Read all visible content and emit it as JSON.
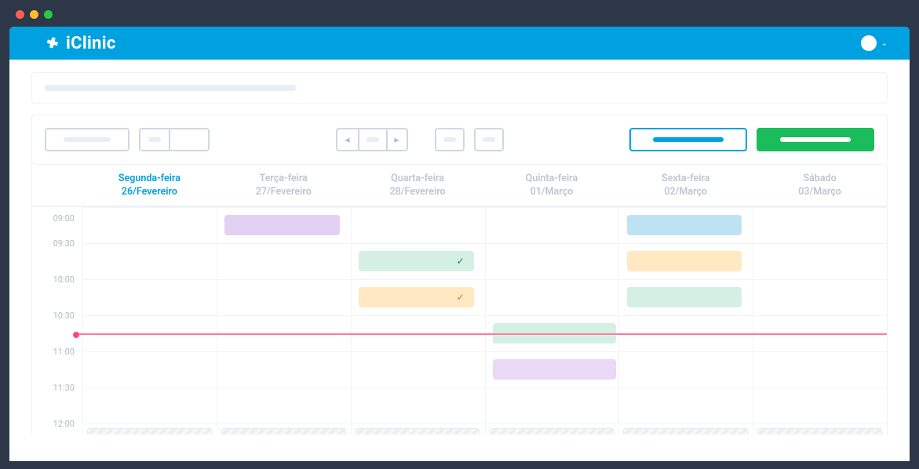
{
  "brand": "iClinic",
  "time_slots": [
    "09:00",
    "09:30",
    "10:00",
    "10:30",
    "11:00",
    "11:30",
    "12:00"
  ],
  "now_line_after_slot_index": 3,
  "days": [
    {
      "name": "Segunda-feira",
      "date": "26/Fevereiro",
      "active": true
    },
    {
      "name": "Terça-feira",
      "date": "27/Fevereiro",
      "active": false
    },
    {
      "name": "Quarta-feira",
      "date": "28/Fevereiro",
      "active": false
    },
    {
      "name": "Quinta-feira",
      "date": "01/Março",
      "active": false
    },
    {
      "name": "Sexta-feira",
      "date": "02/Março",
      "active": false
    },
    {
      "name": "Sábado",
      "date": "03/Março",
      "active": false
    }
  ],
  "events": [
    {
      "day": 1,
      "slot": 0,
      "color": "purple"
    },
    {
      "day": 2,
      "slot": 1,
      "color": "mint",
      "check": "teal"
    },
    {
      "day": 2,
      "slot": 2,
      "color": "peach",
      "check": "orange"
    },
    {
      "day": 3,
      "slot": 3,
      "color": "mint",
      "wide": true
    },
    {
      "day": 3,
      "slot": 4,
      "color": "lilac",
      "wide": true
    },
    {
      "day": 4,
      "slot": 0,
      "color": "blue"
    },
    {
      "day": 4,
      "slot": 1,
      "color": "peach"
    },
    {
      "day": 4,
      "slot": 2,
      "color": "mint2"
    }
  ]
}
